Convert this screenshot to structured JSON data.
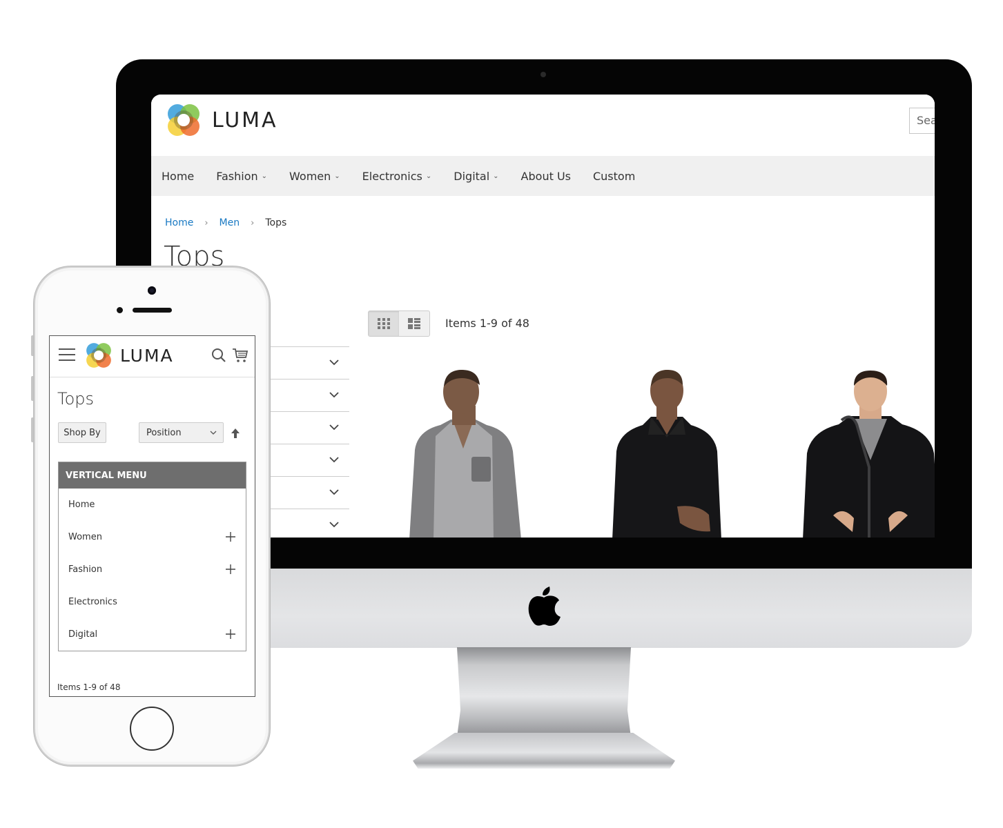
{
  "desktop": {
    "brand": {
      "name": "LUMA",
      "logo_icon": "luma-logo-icon"
    },
    "search": {
      "placeholder": "Sea"
    },
    "nav": {
      "items": [
        {
          "label": "Home",
          "has_dropdown": false
        },
        {
          "label": "Fashion",
          "has_dropdown": true
        },
        {
          "label": "Women",
          "has_dropdown": true
        },
        {
          "label": "Electronics",
          "has_dropdown": true
        },
        {
          "label": "Digital",
          "has_dropdown": true
        },
        {
          "label": "About Us",
          "has_dropdown": false
        },
        {
          "label": "Custom",
          "has_dropdown": false
        }
      ],
      "dropdown_glyph": "⌄"
    },
    "breadcrumb": {
      "items": [
        {
          "label": "Home",
          "link": true
        },
        {
          "label": "Men",
          "link": true
        },
        {
          "label": "Tops",
          "link": false
        }
      ],
      "separator": "›"
    },
    "page_title": "Tops",
    "filters": {
      "count": 6
    },
    "toolbar": {
      "view_modes": [
        {
          "name": "grid",
          "active": true
        },
        {
          "name": "list",
          "active": false
        }
      ],
      "items_count": "Items 1-9 of 48"
    },
    "products": [
      {
        "description": "Man in grey henley hoodie"
      },
      {
        "description": "Man in black pullover hoodie"
      },
      {
        "description": "Man in black zip hoodie with grey tee"
      }
    ]
  },
  "mobile": {
    "brand": {
      "name": "LUMA"
    },
    "page_title": "Tops",
    "shop_by_label": "Shop By",
    "sorter": {
      "selected": "Position"
    },
    "vertical_menu": {
      "title": "VERTICAL MENU",
      "items": [
        {
          "label": "Home",
          "expandable": false
        },
        {
          "label": "Women",
          "expandable": true
        },
        {
          "label": "Fashion",
          "expandable": true
        },
        {
          "label": "Electronics",
          "expandable": false
        },
        {
          "label": "Digital",
          "expandable": true
        }
      ]
    },
    "items_count": "Items 1-9 of 48"
  },
  "colors": {
    "link": "#1979c3",
    "nav_bg": "#f0f0f0",
    "menu_header_bg": "#6e6e6e",
    "logo": [
      "#3fa2dc",
      "#7dc242",
      "#f4cf34",
      "#ef6c2d"
    ]
  }
}
